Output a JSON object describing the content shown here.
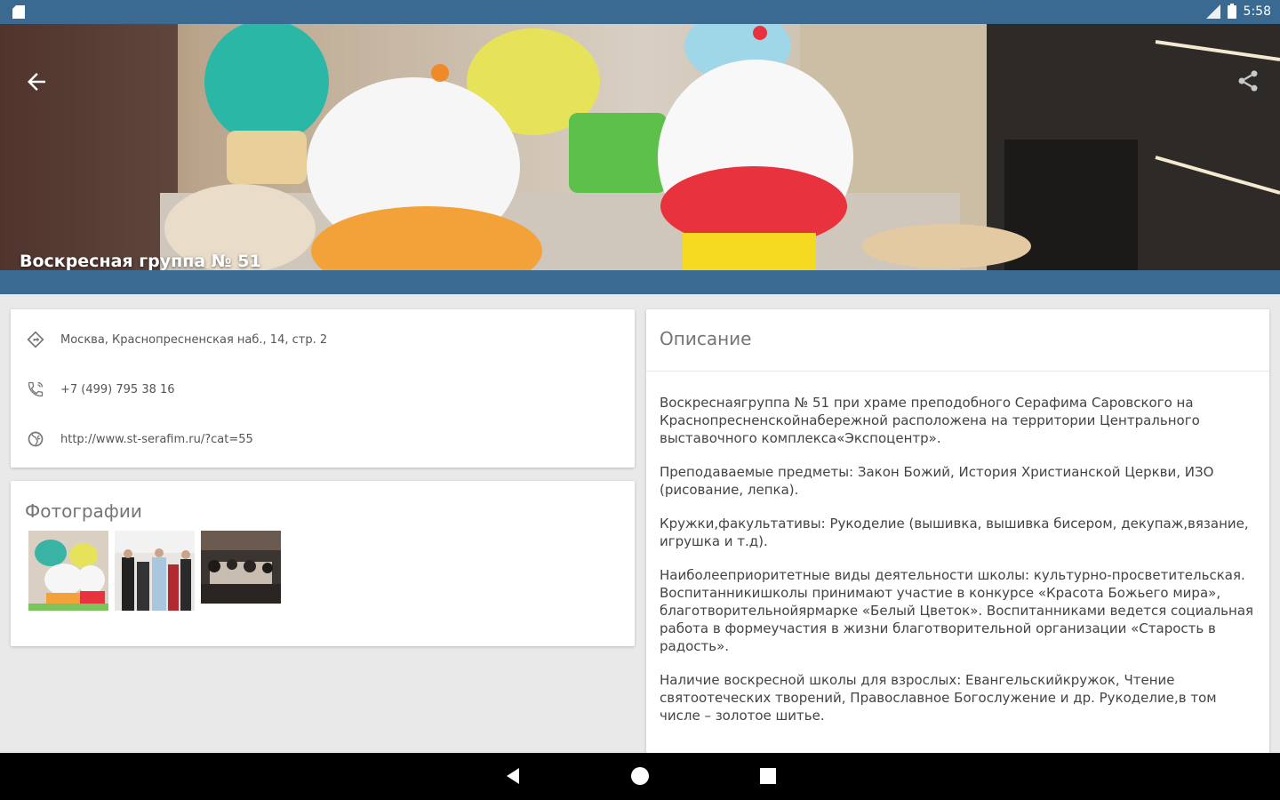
{
  "status_bar": {
    "time": "5:58"
  },
  "header": {
    "title": "Воскресная группа № 51"
  },
  "info": {
    "address": "Москва, Краснопресненская наб., 14, стр. 2",
    "phone": "+7 (499) 795 38 16",
    "website": "http://www.st-serafim.ru/?cat=55"
  },
  "photos": {
    "heading": "Фотографии"
  },
  "description": {
    "heading": "Описание",
    "paragraphs": [
      "Воскреснаягруппа № 51 при храме преподобного Серафима Саровского на Краснопресненскойнабережной расположена на территории Центрального выставочного комплекса«Экспоцентр».",
      "Преподаваемые предметы: Закон Божий, История Христианской Церкви, ИЗО (рисование, лепка).",
      "Кружки,факультативы: Рукоделие (вышивка, вышивка бисером, декупаж,вязание, игрушка и т.д).",
      "Наиболееприоритетные виды деятельности школы: культурно-просветительская. Воспитанникишколы принимают участие в конкурсе «Красота Божьего мира», благотворительнойярмарке «Белый Цветок». Воспитанниками ведется социальная работа в формеучастия в жизни благотворительной организации «Старость в радость».",
      "Наличие воскресной школы для взрослых: Евангельскийкружок, Чтение святоотеческих творений, Православное Богослужение и др. Рукоделие,в том числе – золотое шитье."
    ]
  },
  "colors": {
    "primary": "#3a6a92",
    "background": "#e9e9e9"
  },
  "icons": {
    "back": "arrow-left-icon",
    "share": "share-icon",
    "address": "directions-diamond-icon",
    "phone": "phone-icon",
    "website": "globe-icon"
  }
}
